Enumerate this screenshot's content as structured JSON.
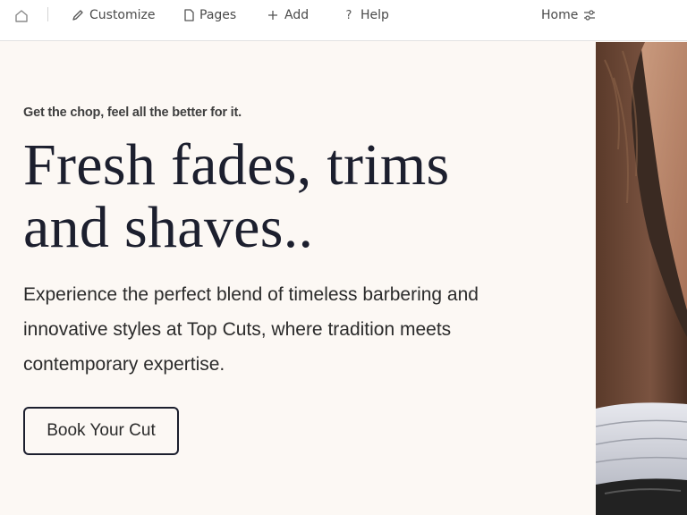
{
  "toolbar": {
    "home_icon": "home-icon",
    "items": [
      {
        "label": "Customize",
        "icon": "pencil-icon"
      },
      {
        "label": "Pages",
        "icon": "page-icon"
      },
      {
        "label": "Add",
        "icon": "plus-icon"
      },
      {
        "label": "Help",
        "icon": "question-icon"
      }
    ],
    "page_select": {
      "label": "Home",
      "icon": "sliders-icon"
    }
  },
  "hero": {
    "tagline": "Get the chop, feel all the better for it.",
    "headline_line1": "Fresh fades, trims",
    "headline_line2": "and shaves..",
    "description": "Experience the perfect blend of timeless barbering and innovative styles at Top Cuts, where tradition meets contemporary expertise.",
    "cta_label": "Book Your Cut",
    "photo_alt": "barber-client-photo"
  },
  "colors": {
    "background": "#fcf8f4",
    "text_dark": "#1c1f2e",
    "toolbar_bg": "#ffffff"
  }
}
